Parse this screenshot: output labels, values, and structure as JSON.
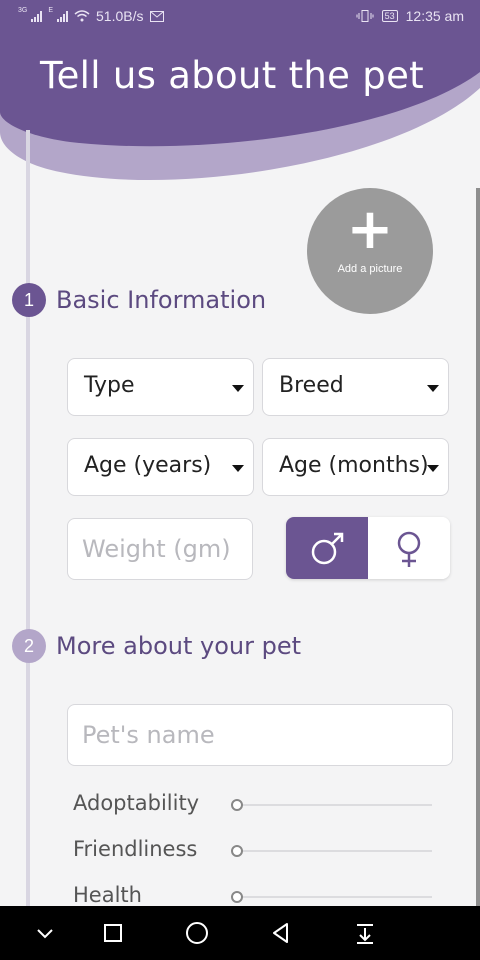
{
  "status_bar": {
    "net_3g": "3G",
    "net_e": "E",
    "speed": "51.0B/s",
    "battery": "53",
    "time": "12:35 am"
  },
  "header": {
    "title": "Tell us about the pet"
  },
  "add_picture": {
    "label": "Add a picture"
  },
  "section1": {
    "number": "1",
    "title": "Basic Information"
  },
  "form": {
    "type": "Type",
    "breed": "Breed",
    "age_years": "Age (years)",
    "age_months": "Age (months)",
    "weight_placeholder": "Weight (gm)"
  },
  "section2": {
    "number": "2",
    "title": "More about your pet"
  },
  "pet_name_placeholder": "Pet's name",
  "sliders": [
    {
      "label": "Adoptability",
      "value": 0
    },
    {
      "label": "Friendliness",
      "value": 0
    },
    {
      "label": "Health",
      "value": 0
    }
  ],
  "colors": {
    "primary": "#6b5592",
    "secondary": "#b3a6c9"
  }
}
